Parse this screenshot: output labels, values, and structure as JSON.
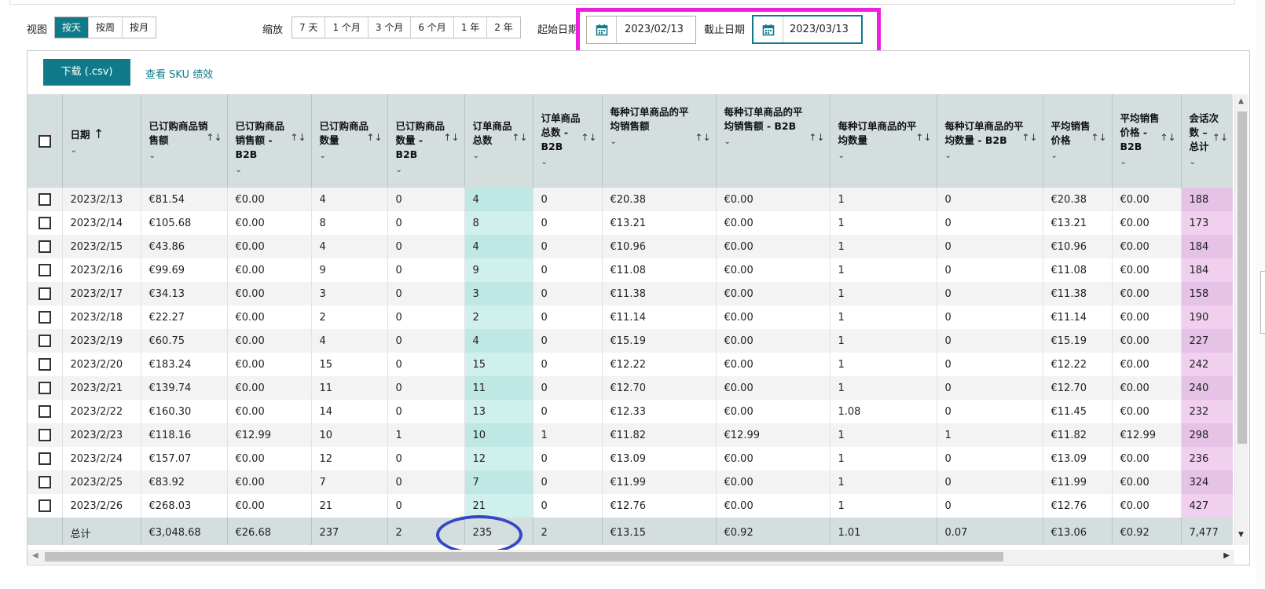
{
  "toolbar": {
    "view_label": "视图",
    "view_options": [
      "按天",
      "按周",
      "按月"
    ],
    "view_active": "按天",
    "zoom_label": "缩放",
    "zoom_options": [
      "7 天",
      "1 个月",
      "3 个月",
      "6 个月",
      "1 年",
      "2 年"
    ],
    "start_label": "起始日期",
    "start_value": "2023/02/13",
    "end_label": "截止日期",
    "end_value": "2023/03/13"
  },
  "actions": {
    "download_label": "下载 (.csv)",
    "sku_link": "查看 SKU 绩效"
  },
  "table": {
    "headers": [
      "日期",
      "已订购商品销售额",
      "已订购商品销售额 - B2B",
      "已订购商品数量",
      "已订购商品数量 - B2B",
      "订单商品总数",
      "订单商品总数 - B2B",
      "每种订单商品的平均销售额",
      "每种订单商品的平均销售额 - B2B",
      "每种订单商品的平均数量",
      "每种订单商品的平均数量 - B2B",
      "平均销售价格",
      "平均销售价格 - B2B",
      "会话次数 – 总计"
    ],
    "rows": [
      [
        "2023/2/13",
        "€81.54",
        "€0.00",
        "4",
        "0",
        "4",
        "0",
        "€20.38",
        "€0.00",
        "1",
        "0",
        "€20.38",
        "€0.00",
        "188"
      ],
      [
        "2023/2/14",
        "€105.68",
        "€0.00",
        "8",
        "0",
        "8",
        "0",
        "€13.21",
        "€0.00",
        "1",
        "0",
        "€13.21",
        "€0.00",
        "173"
      ],
      [
        "2023/2/15",
        "€43.86",
        "€0.00",
        "4",
        "0",
        "4",
        "0",
        "€10.96",
        "€0.00",
        "1",
        "0",
        "€10.96",
        "€0.00",
        "184"
      ],
      [
        "2023/2/16",
        "€99.69",
        "€0.00",
        "9",
        "0",
        "9",
        "0",
        "€11.08",
        "€0.00",
        "1",
        "0",
        "€11.08",
        "€0.00",
        "184"
      ],
      [
        "2023/2/17",
        "€34.13",
        "€0.00",
        "3",
        "0",
        "3",
        "0",
        "€11.38",
        "€0.00",
        "1",
        "0",
        "€11.38",
        "€0.00",
        "158"
      ],
      [
        "2023/2/18",
        "€22.27",
        "€0.00",
        "2",
        "0",
        "2",
        "0",
        "€11.14",
        "€0.00",
        "1",
        "0",
        "€11.14",
        "€0.00",
        "190"
      ],
      [
        "2023/2/19",
        "€60.75",
        "€0.00",
        "4",
        "0",
        "4",
        "0",
        "€15.19",
        "€0.00",
        "1",
        "0",
        "€15.19",
        "€0.00",
        "227"
      ],
      [
        "2023/2/20",
        "€183.24",
        "€0.00",
        "15",
        "0",
        "15",
        "0",
        "€12.22",
        "€0.00",
        "1",
        "0",
        "€12.22",
        "€0.00",
        "242"
      ],
      [
        "2023/2/21",
        "€139.74",
        "€0.00",
        "11",
        "0",
        "11",
        "0",
        "€12.70",
        "€0.00",
        "1",
        "0",
        "€12.70",
        "€0.00",
        "240"
      ],
      [
        "2023/2/22",
        "€160.30",
        "€0.00",
        "14",
        "0",
        "13",
        "0",
        "€12.33",
        "€0.00",
        "1.08",
        "0",
        "€11.45",
        "€0.00",
        "232"
      ],
      [
        "2023/2/23",
        "€118.16",
        "€12.99",
        "10",
        "1",
        "10",
        "1",
        "€11.82",
        "€12.99",
        "1",
        "1",
        "€11.82",
        "€12.99",
        "298"
      ],
      [
        "2023/2/24",
        "€157.07",
        "€0.00",
        "12",
        "0",
        "12",
        "0",
        "€13.09",
        "€0.00",
        "1",
        "0",
        "€13.09",
        "€0.00",
        "236"
      ],
      [
        "2023/2/25",
        "€83.92",
        "€0.00",
        "7",
        "0",
        "7",
        "0",
        "€11.99",
        "€0.00",
        "1",
        "0",
        "€11.99",
        "€0.00",
        "324"
      ],
      [
        "2023/2/26",
        "€268.03",
        "€0.00",
        "21",
        "0",
        "21",
        "0",
        "€12.76",
        "€0.00",
        "1",
        "0",
        "€12.76",
        "€0.00",
        "427"
      ]
    ],
    "totals": [
      "总计",
      "€3,048.68",
      "€26.68",
      "237",
      "2",
      "235",
      "2",
      "€13.15",
      "€0.92",
      "1.01",
      "0.07",
      "€13.06",
      "€0.92",
      "7,477"
    ]
  },
  "colors": {
    "accent": "#0f7b8a",
    "annotation_box": "#ee1ee0",
    "annotation_circle": "#3347c9",
    "teal_highlight": "#bfe8e5",
    "pink_highlight": "#e5c2e6"
  },
  "icons": {
    "calendar": "calendar-icon",
    "sort": "sort-toggle-icon",
    "sort_asc": "arrow-up-icon",
    "chevron": "chevron-down-icon"
  }
}
